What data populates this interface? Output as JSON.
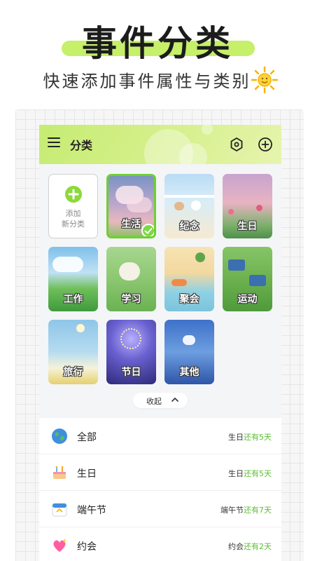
{
  "hero": {
    "title": "事件分类",
    "subtitle": "快速添加事件属性与类别",
    "icon": "sun-icon"
  },
  "appbar": {
    "title": "分类",
    "menu_icon": "menu-icon",
    "settings_icon": "hexagon-settings-icon",
    "add_icon": "plus-circle-icon"
  },
  "categories": {
    "add_line1": "添加",
    "add_line2": "新分类",
    "items": [
      {
        "label": "生活",
        "selected": true
      },
      {
        "label": "纪念"
      },
      {
        "label": "生日"
      },
      {
        "label": "工作"
      },
      {
        "label": "学习"
      },
      {
        "label": "聚会"
      },
      {
        "label": "运动"
      },
      {
        "label": "旅行"
      },
      {
        "label": "节日"
      },
      {
        "label": "其他"
      }
    ]
  },
  "collapse_label": "收起",
  "events": [
    {
      "name": "全部",
      "icon": "globe-icon",
      "target": "生日",
      "remain": "还有5天"
    },
    {
      "name": "生日",
      "icon": "birthday-cake-icon",
      "target": "生日",
      "remain": "还有5天"
    },
    {
      "name": "端午节",
      "icon": "calendar-icon",
      "target": "端午节",
      "remain": "还有7天"
    },
    {
      "name": "约会",
      "icon": "sparkling-heart-icon",
      "target": "约会",
      "remain": "还有2天"
    }
  ],
  "colors": {
    "accent": "#8bd93a",
    "highlight_text": "#5bbf34",
    "appbar": "#c5ec72"
  }
}
